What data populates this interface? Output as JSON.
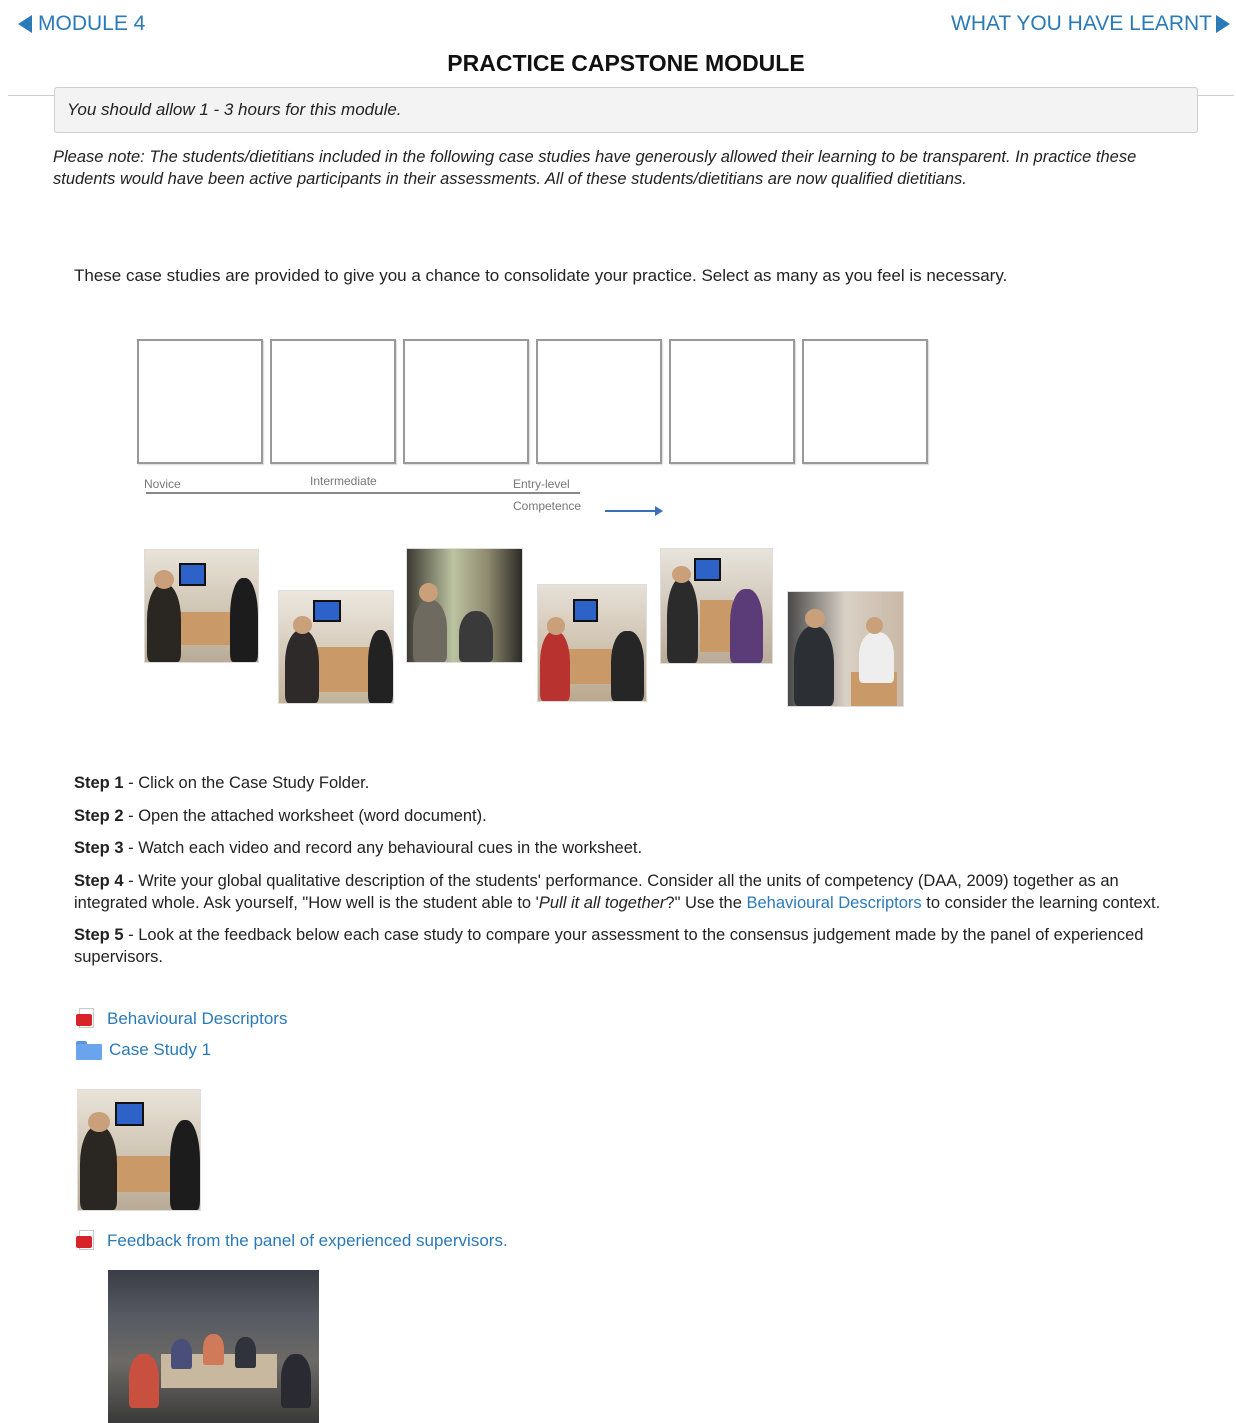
{
  "nav": {
    "prev_label": "MODULE 4",
    "next_label": "WHAT YOU HAVE LEARNT"
  },
  "page_title": "PRACTICE CAPSTONE MODULE",
  "notice": "You should allow 1 - 3 hours for this module.",
  "please_note": "Please note:  The students/dietitians included in the following case studies have generously allowed their learning to be transparent.  In practice these students would have been active participants in their assessments.  All of these students/dietitians are now qualified dietitians.",
  "intro": "These case studies are provided to give you a chance to consolidate your practice.  Select as many as you feel is necessary.",
  "scale": {
    "novice": "Novice",
    "intermediate": "Intermediate",
    "entry_level": "Entry-level",
    "competence": "Competence"
  },
  "steps": {
    "s1_label": "Step 1",
    "s1_text": " - Click on the Case Study Folder.",
    "s2_label": "Step 2",
    "s2_text": " - Open the attached worksheet (word document).",
    "s3_label": "Step 3",
    "s3_text": " - Watch each video and record any behavioural cues in the worksheet.",
    "s4_label": "Step 4",
    "s4_text_a": " - Write your global qualitative description of the students' performance.  Consider all the units of competency (DAA, 2009) together as an integrated whole. Ask yourself, \"How well is the student able to '",
    "s4_italic": "Pull it all together",
    "s4_text_b": "?\" Use the ",
    "s4_link": "Behavioural Descriptors",
    "s4_text_c": " to consider the learning context.",
    "s5_label": "Step 5",
    "s5_text": " - Look at the feedback below each case study to compare your assessment to the consensus judgement made by the panel of experienced supervisors."
  },
  "resources": {
    "behavioural_descriptors": "Behavioural Descriptors",
    "case_study_1": "Case Study 1",
    "feedback": "Feedback from the panel of experienced supervisors."
  },
  "icons": {
    "prev": "triangle-left-icon",
    "next": "triangle-right-icon",
    "pdf": "pdf-icon",
    "folder": "folder-icon"
  },
  "colors": {
    "link": "#2a7ab8",
    "pdf_red": "#d8232a",
    "folder_blue": "#6aa4ec"
  }
}
